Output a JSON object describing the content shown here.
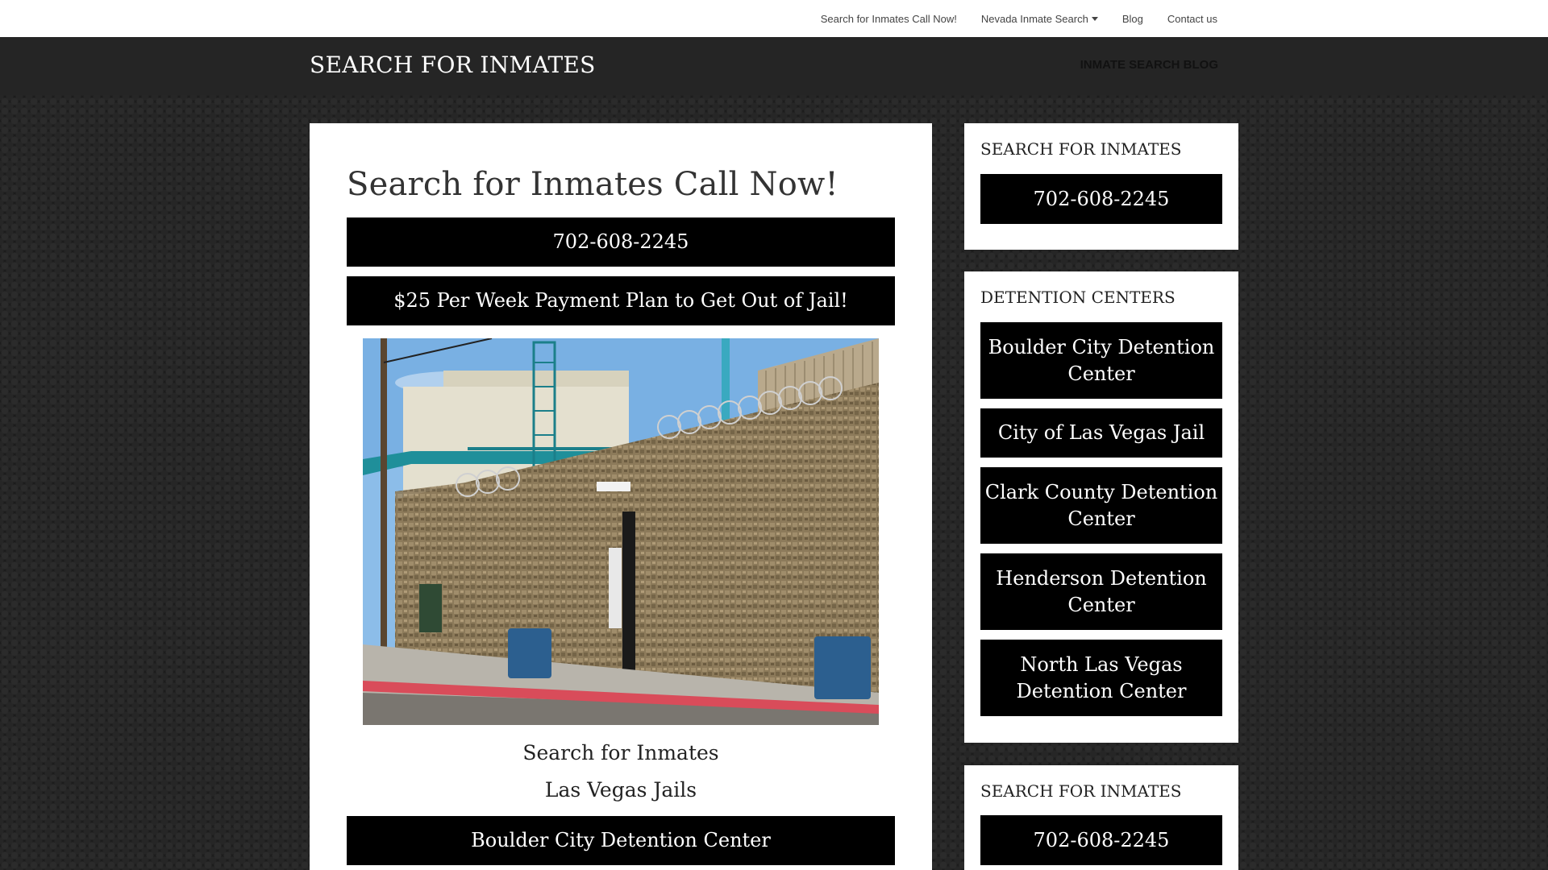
{
  "topnav": {
    "items": [
      {
        "label": "Search for Inmates Call Now!"
      },
      {
        "label": "Nevada Inmate Search",
        "has_dropdown": true
      },
      {
        "label": "Blog"
      },
      {
        "label": "Contact us"
      }
    ]
  },
  "header": {
    "site_title": "SEARCH FOR INMATES",
    "link": "INMATE SEARCH BLOG"
  },
  "main": {
    "title": "Search for Inmates Call Now!",
    "phone_button": "702-608-2245",
    "plan_button": "$25 Per Week Payment Plan to Get Out of Jail!",
    "caption_1": "Search for Inmates",
    "caption_2": "Las Vegas Jails",
    "facility_button": "Boulder City Detention Center"
  },
  "sidebar": {
    "widget_1": {
      "title": "SEARCH FOR INMATES",
      "button": "702-608-2245"
    },
    "widget_2": {
      "title": "DETENTION CENTERS",
      "buttons": [
        {
          "label": "Boulder City Detention Center"
        },
        {
          "label": "City of Las Vegas Jail"
        },
        {
          "label": "Clark County Detention Center"
        },
        {
          "label": "Henderson Detention Center"
        },
        {
          "label": "North Las Vegas Detention Center"
        }
      ]
    },
    "widget_3": {
      "title": "SEARCH FOR INMATES",
      "button": "702-608-2245"
    }
  },
  "colors": {
    "background": "#1d1d1d",
    "header": "#252525",
    "button": "#000000",
    "card": "#ffffff"
  }
}
